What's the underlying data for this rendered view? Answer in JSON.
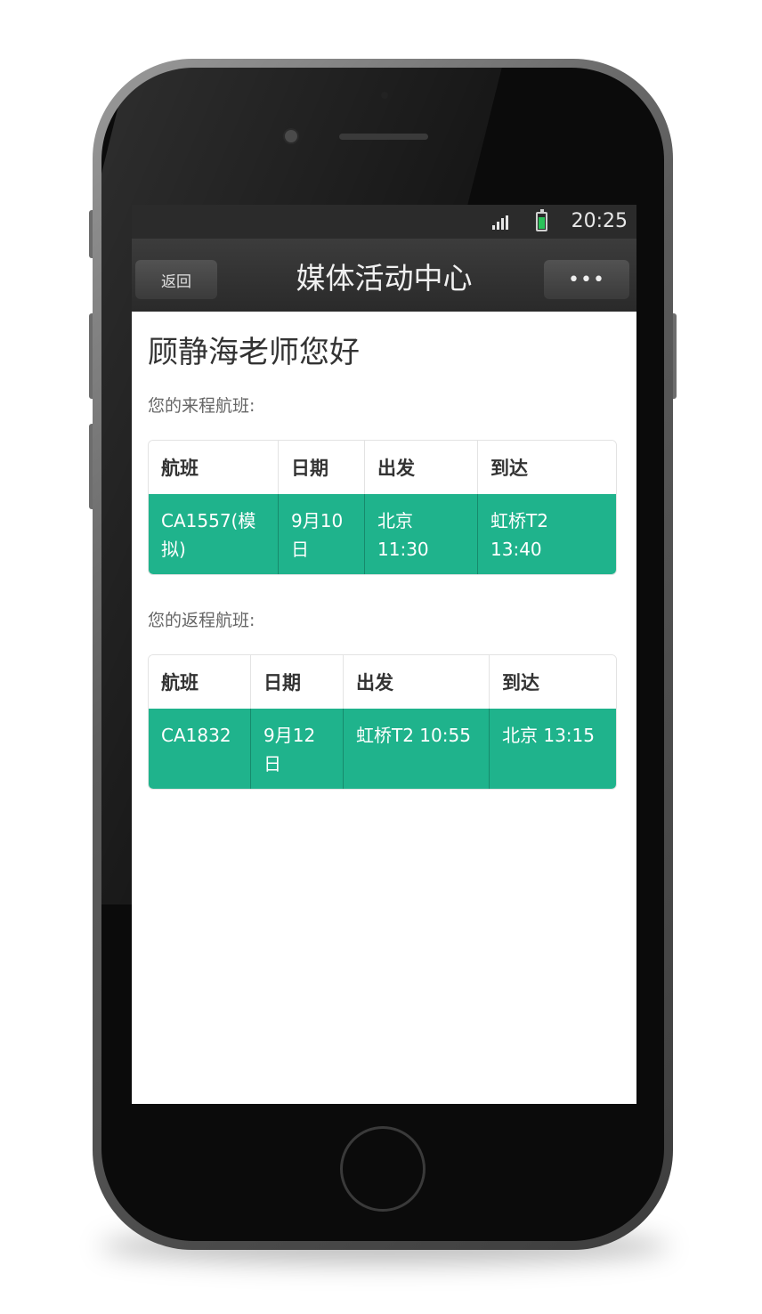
{
  "status_bar": {
    "time": "20:25"
  },
  "nav": {
    "back_label": "返回",
    "title": "媒体活动中心",
    "more_label": "•••"
  },
  "greeting": "顾静海老师您好",
  "outbound": {
    "label": "您的来程航班:",
    "headers": [
      "航班",
      "日期",
      "出发",
      "到达"
    ],
    "row": {
      "flight": "CA1557(模拟)",
      "date": "9月10日",
      "departure": "北京 11:30",
      "arrival": "虹桥T2 13:40"
    }
  },
  "return": {
    "label": "您的返程航班:",
    "headers": [
      "航班",
      "日期",
      "出发",
      "到达"
    ],
    "row": {
      "flight": "CA1832",
      "date": "9月12日",
      "departure": "虹桥T2 10:55",
      "arrival": "北京 13:15"
    }
  },
  "colors": {
    "accent": "#1fb38c",
    "navbar": "#2f2f2f"
  }
}
